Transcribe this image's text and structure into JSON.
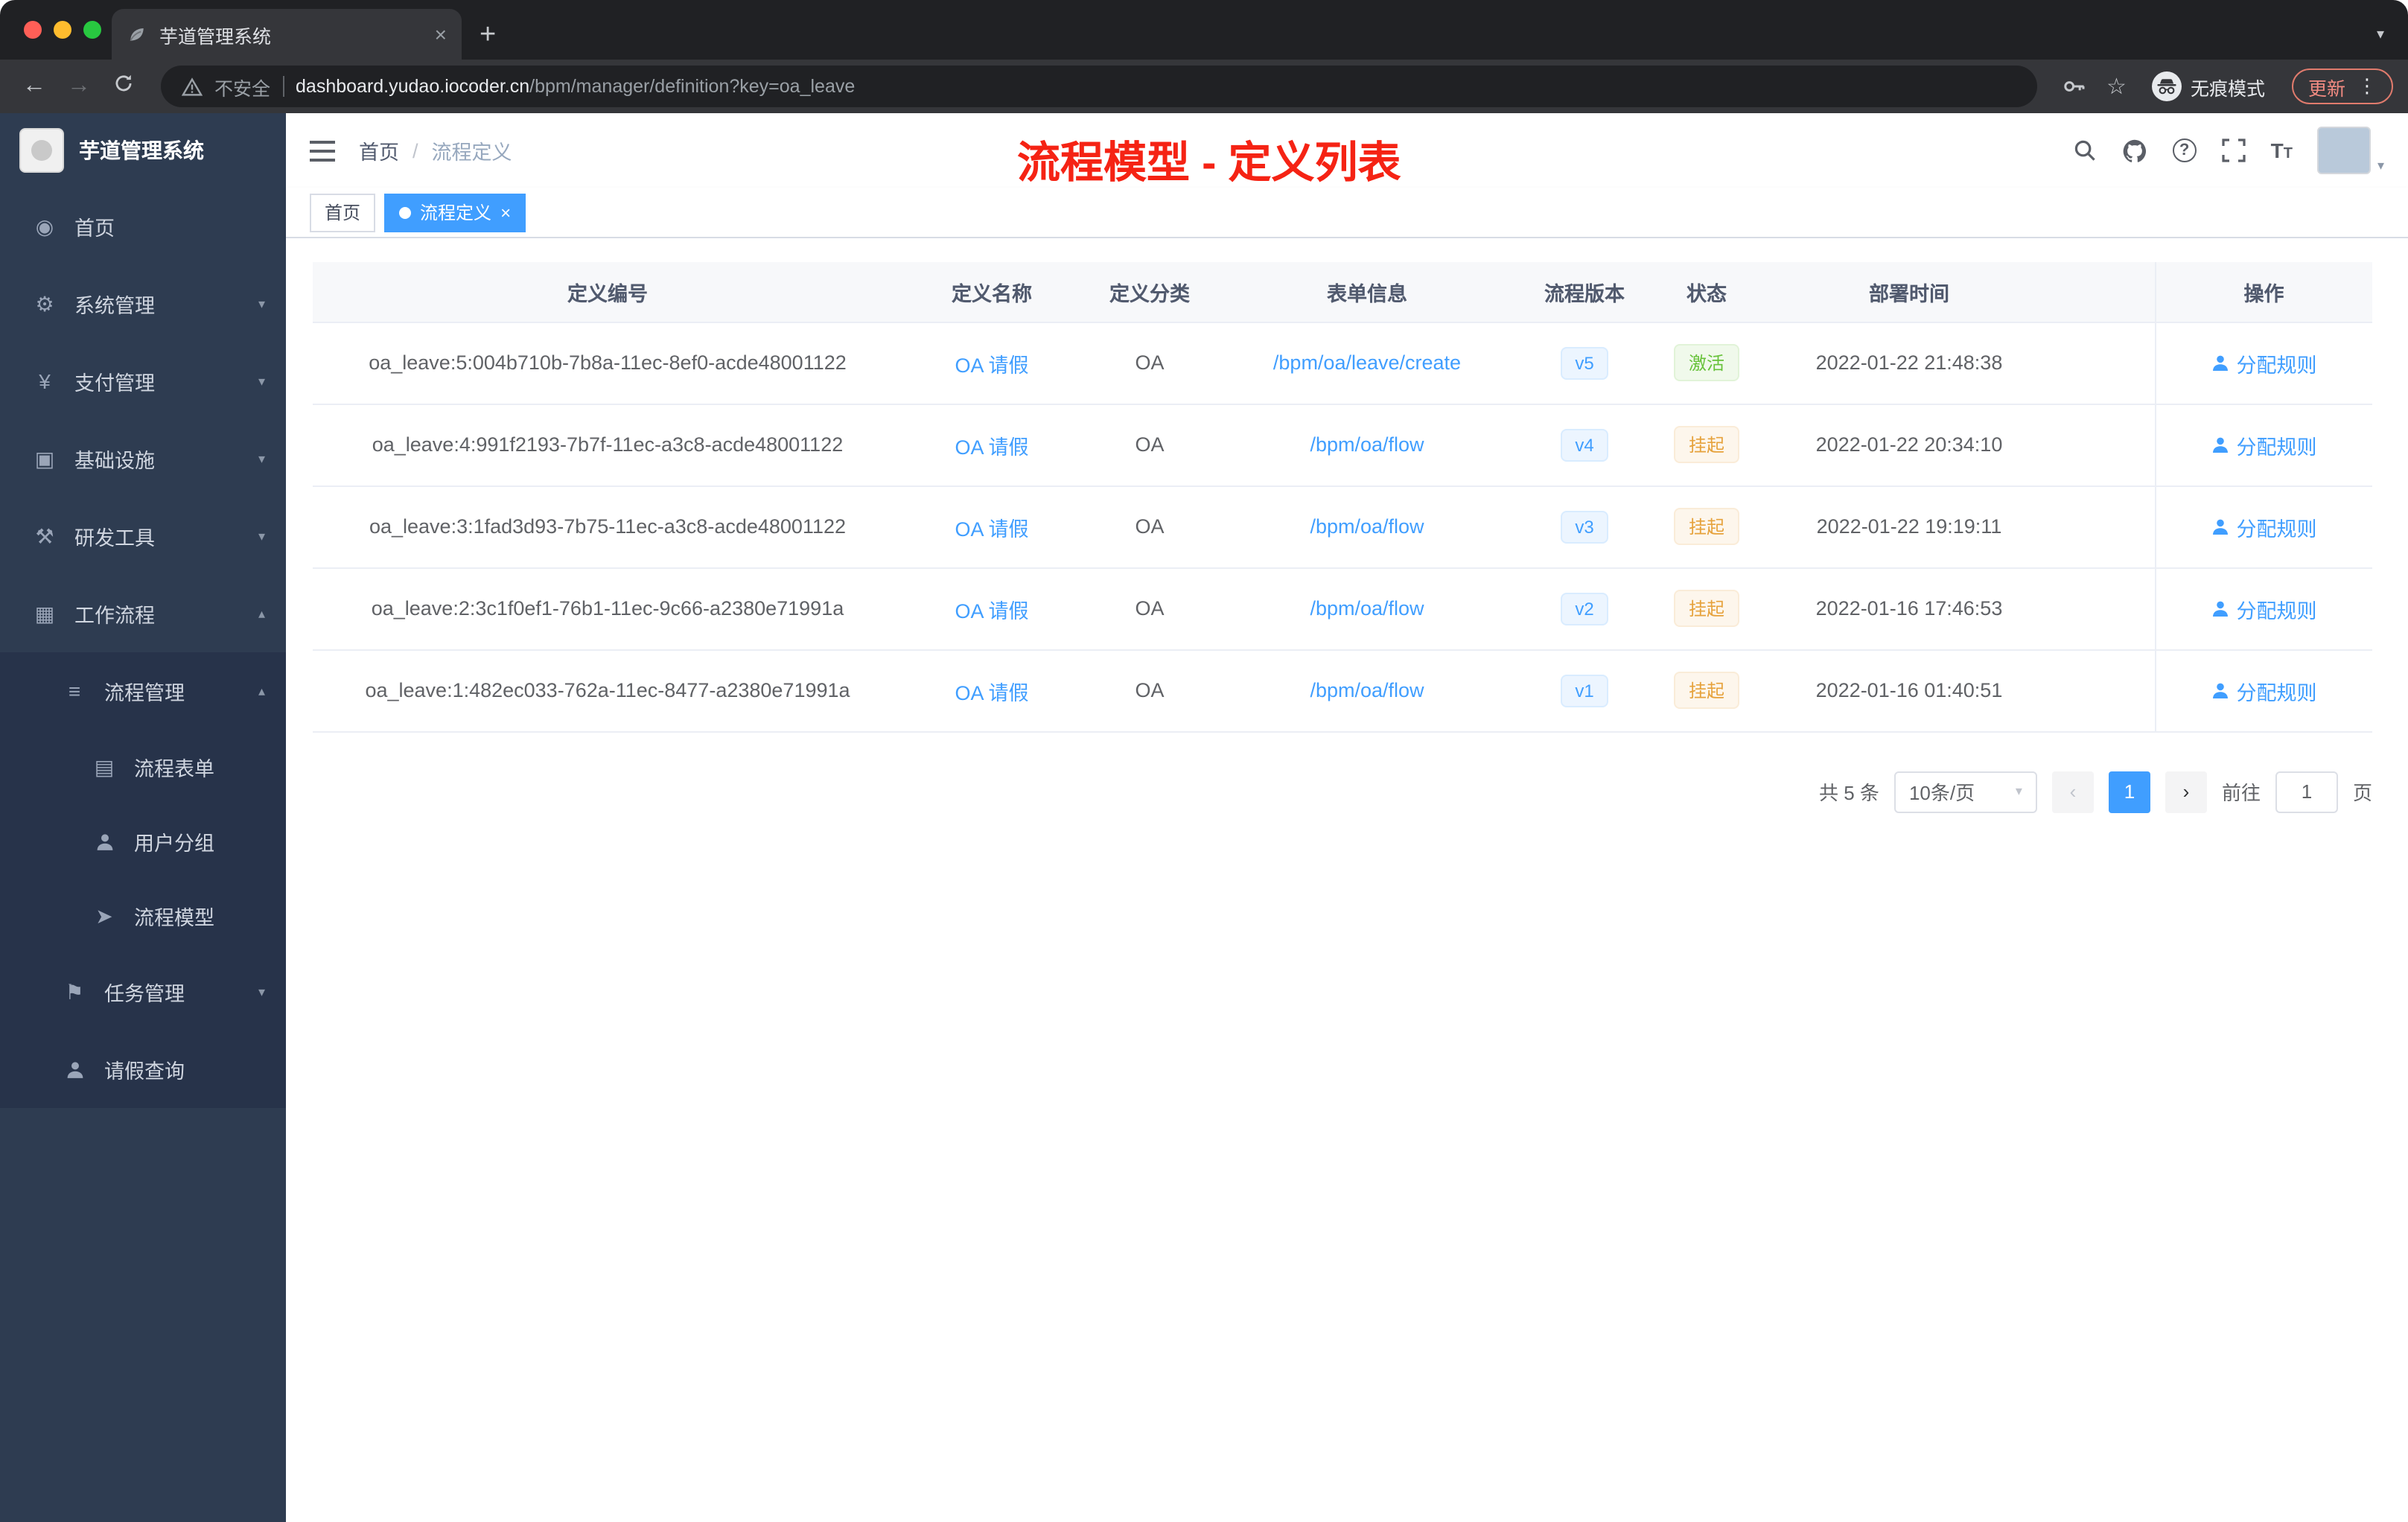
{
  "colors": {
    "accent": "#409eff",
    "success": "#67c23a",
    "warning": "#e6a23c",
    "annotation_red": "#f52314",
    "sidebar_bg": "#2e3c51",
    "submenu_bg": "#27334a"
  },
  "browser": {
    "tab_title": "芋道管理系统",
    "security_label": "不安全",
    "url_host": "dashboard.yudao.iocoder.cn",
    "url_path": "/bpm/manager/definition?key=oa_leave",
    "incognito_label": "无痕模式",
    "update_label": "更新"
  },
  "sidebar": {
    "logo_title": "芋道管理系统",
    "items": [
      {
        "label": "首页",
        "icon": "dashboard"
      },
      {
        "label": "系统管理",
        "icon": "gear"
      },
      {
        "label": "支付管理",
        "icon": "yen"
      },
      {
        "label": "基础设施",
        "icon": "infrastructure"
      },
      {
        "label": "研发工具",
        "icon": "tools"
      },
      {
        "label": "工作流程",
        "icon": "workflow"
      },
      {
        "label": "流程管理",
        "icon": "process-list"
      },
      {
        "label": "流程表单",
        "icon": "form"
      },
      {
        "label": "用户分组",
        "icon": "user-group"
      },
      {
        "label": "流程模型",
        "icon": "paper-plane"
      },
      {
        "label": "任务管理",
        "icon": "task"
      },
      {
        "label": "请假查询",
        "icon": "person"
      }
    ]
  },
  "header": {
    "breadcrumb_home": "首页",
    "breadcrumb_sep": "/",
    "breadcrumb_current": "流程定义",
    "annotation": "流程模型 - 定义列表"
  },
  "tags": {
    "first": "首页",
    "active": "流程定义"
  },
  "table": {
    "columns": {
      "id": "定义编号",
      "name": "定义名称",
      "category": "定义分类",
      "form": "表单信息",
      "version": "流程版本",
      "status": "状态",
      "deploy_time": "部署时间",
      "actions": "操作"
    },
    "action_label": "分配规则",
    "rows": [
      {
        "id": "oa_leave:5:004b710b-7b8a-11ec-8ef0-acde48001122",
        "name": "OA 请假",
        "category": "OA",
        "form_link": "/bpm/oa/leave/create",
        "version": "v5",
        "status": "激活",
        "status_type": "success",
        "deploy_time": "2022-01-22 21:48:38"
      },
      {
        "id": "oa_leave:4:991f2193-7b7f-11ec-a3c8-acde48001122",
        "name": "OA 请假",
        "category": "OA",
        "form_link": "/bpm/oa/flow",
        "version": "v4",
        "status": "挂起",
        "status_type": "warning",
        "deploy_time": "2022-01-22 20:34:10"
      },
      {
        "id": "oa_leave:3:1fad3d93-7b75-11ec-a3c8-acde48001122",
        "name": "OA 请假",
        "category": "OA",
        "form_link": "/bpm/oa/flow",
        "version": "v3",
        "status": "挂起",
        "status_type": "warning",
        "deploy_time": "2022-01-22 19:19:11"
      },
      {
        "id": "oa_leave:2:3c1f0ef1-76b1-11ec-9c66-a2380e71991a",
        "name": "OA 请假",
        "category": "OA",
        "form_link": "/bpm/oa/flow",
        "version": "v2",
        "status": "挂起",
        "status_type": "warning",
        "deploy_time": "2022-01-16 17:46:53"
      },
      {
        "id": "oa_leave:1:482ec033-762a-11ec-8477-a2380e71991a",
        "name": "OA 请假",
        "category": "OA",
        "form_link": "/bpm/oa/flow",
        "version": "v1",
        "status": "挂起",
        "status_type": "warning",
        "deploy_time": "2022-01-16 01:40:51"
      }
    ]
  },
  "pagination": {
    "total": "共 5 条",
    "page_size": "10条/页",
    "page": "1",
    "goto_label": "前往",
    "goto_value": "1",
    "goto_unit": "页"
  }
}
